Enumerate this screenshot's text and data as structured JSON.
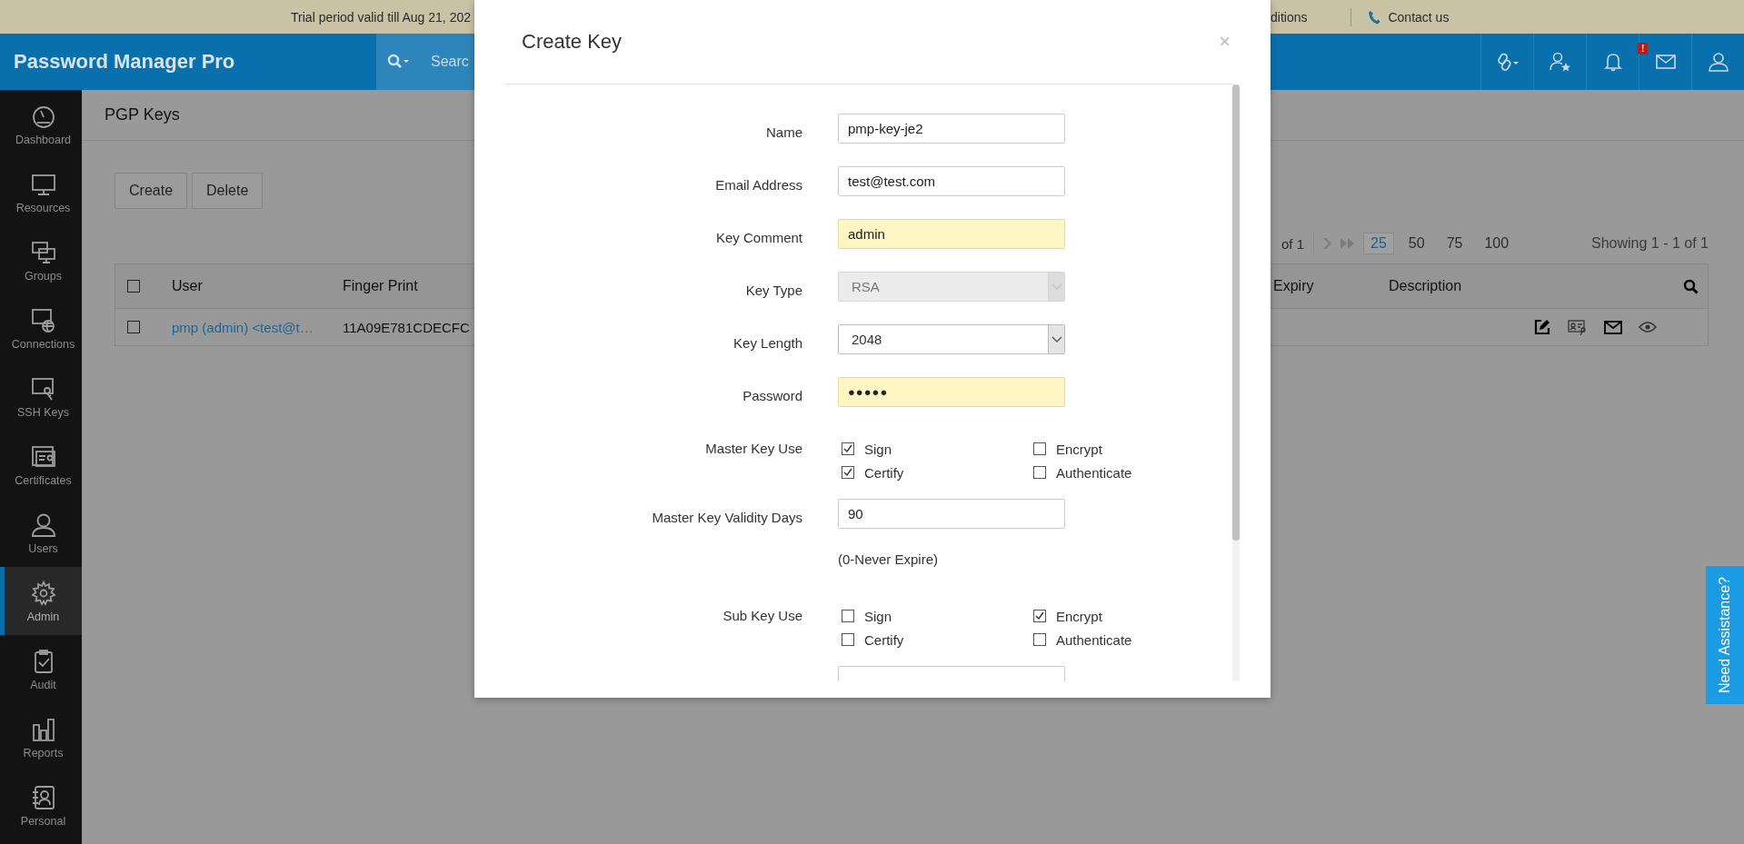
{
  "trial_bar": {
    "notice": "Trial period valid till Aug 21, 202",
    "editions_link": "ditions",
    "contact_link": "Contact us"
  },
  "header": {
    "logo": "Password Manager Pro",
    "search_placeholder": "Searc",
    "notification_badge": "!"
  },
  "sidebar": {
    "items": [
      {
        "label": "Dashboard",
        "selected": false
      },
      {
        "label": "Resources",
        "selected": false
      },
      {
        "label": "Groups",
        "selected": false
      },
      {
        "label": "Connections",
        "selected": false
      },
      {
        "label": "SSH Keys",
        "selected": false
      },
      {
        "label": "Certificates",
        "selected": false
      },
      {
        "label": "Users",
        "selected": false
      },
      {
        "label": "Admin",
        "selected": true
      },
      {
        "label": "Audit",
        "selected": false
      },
      {
        "label": "Reports",
        "selected": false
      },
      {
        "label": "Personal",
        "selected": false
      }
    ]
  },
  "page": {
    "title": "PGP Keys",
    "buttons": [
      "Create",
      "Delete"
    ],
    "pagination": {
      "of_pages": "of 1",
      "page_sizes": [
        {
          "label": "25",
          "selected": true
        },
        {
          "label": "50",
          "selected": false
        },
        {
          "label": "75",
          "selected": false
        },
        {
          "label": "100",
          "selected": false
        }
      ],
      "showing": "Showing 1 - 1 of 1"
    },
    "table": {
      "header_checked": false,
      "columns": [
        "User",
        "Finger Print",
        "Expiry",
        "Description"
      ],
      "rows": [
        {
          "checked": false,
          "user": "pmp (admin) <test@t…",
          "fingerprint": "11A09E781CDECFC"
        }
      ]
    }
  },
  "dialog": {
    "title": "Create Key",
    "close": "×",
    "fields": [
      {
        "kind": "text",
        "label": "Name",
        "value": "pmp-key-je2",
        "highlighted": false
      },
      {
        "kind": "text",
        "label": "Email Address",
        "value": "test@test.com",
        "highlighted": false
      },
      {
        "kind": "text",
        "label": "Key Comment",
        "value": "admin",
        "highlighted": true
      },
      {
        "kind": "select",
        "label": "Key Type",
        "value": "RSA",
        "disabled": true
      },
      {
        "kind": "select",
        "label": "Key Length",
        "value": "2048",
        "disabled": false
      },
      {
        "kind": "password",
        "label": "Password",
        "value": "●●●●●",
        "highlighted": true
      },
      {
        "kind": "checks",
        "label": "Master Key Use",
        "options": [
          {
            "label": "Sign",
            "checked": true
          },
          {
            "label": "Encrypt",
            "checked": false
          },
          {
            "label": "Certify",
            "checked": true
          },
          {
            "label": "Authenticate",
            "checked": false
          }
        ]
      },
      {
        "kind": "text",
        "label": "Master Key Validity Days",
        "value": "90",
        "highlighted": false
      },
      {
        "kind": "note",
        "value": "(0-Never Expire)"
      },
      {
        "kind": "checks",
        "label": "Sub Key Use",
        "options": [
          {
            "label": "Sign",
            "checked": false
          },
          {
            "label": "Encrypt",
            "checked": true
          },
          {
            "label": "Certify",
            "checked": false
          },
          {
            "label": "Authenticate",
            "checked": false
          }
        ]
      },
      {
        "kind": "text",
        "highlighted": false
      }
    ]
  },
  "help_tab": "Need Assistance?"
}
